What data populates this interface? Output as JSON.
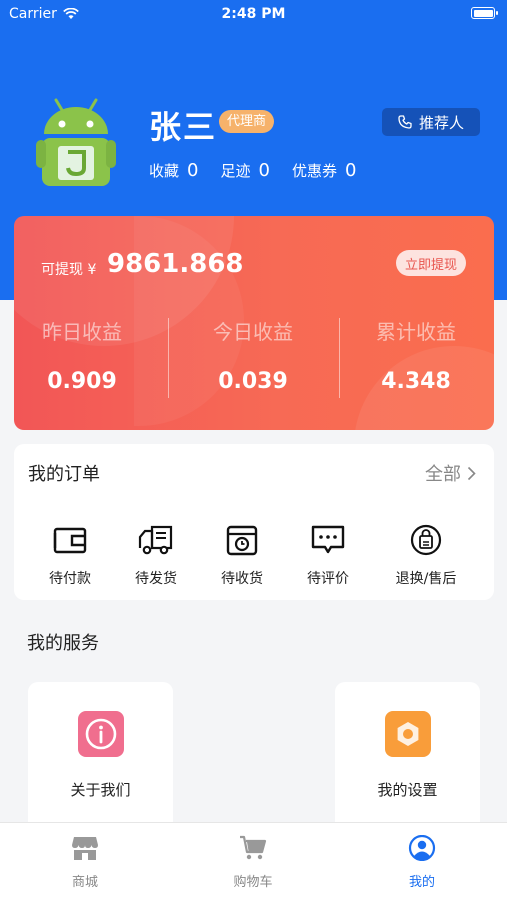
{
  "status_bar": {
    "carrier": "Carrier",
    "time": "2:48 PM"
  },
  "profile": {
    "name": "张三",
    "role_badge": "代理商",
    "referrer_label": "推荐人",
    "stats": [
      {
        "label": "收藏",
        "value": "0"
      },
      {
        "label": "足迹",
        "value": "0"
      },
      {
        "label": "优惠券",
        "value": "0"
      }
    ]
  },
  "earnings": {
    "withdrawable_label": "可提现 ¥",
    "withdrawable_amount": "9861.868",
    "withdraw_button": "立即提现",
    "columns": [
      {
        "label": "昨日收益",
        "value": "0.909"
      },
      {
        "label": "今日收益",
        "value": "0.039"
      },
      {
        "label": "累计收益",
        "value": "4.348"
      }
    ]
  },
  "orders": {
    "title": "我的订单",
    "all_label": "全部",
    "items": [
      {
        "label": "待付款",
        "icon": "wallet-icon"
      },
      {
        "label": "待发货",
        "icon": "truck-icon"
      },
      {
        "label": "待收货",
        "icon": "package-icon"
      },
      {
        "label": "待评价",
        "icon": "comment-icon"
      },
      {
        "label": "退换/售后",
        "icon": "return-bag-icon"
      }
    ]
  },
  "services": {
    "title": "我的服务",
    "items": [
      {
        "label": "关于我们",
        "icon": "info-icon",
        "color": "#f06e8e"
      },
      {
        "label": "我的设置",
        "icon": "settings-icon",
        "color": "#f99d3a"
      }
    ]
  },
  "tab_bar": {
    "active_color": "#1a6ef0",
    "items": [
      {
        "label": "商城",
        "icon": "store-icon",
        "active": false
      },
      {
        "label": "购物车",
        "icon": "cart-icon",
        "active": false
      },
      {
        "label": "我的",
        "icon": "user-icon",
        "active": true
      }
    ]
  },
  "colors": {
    "header_blue": "#1a6ef0",
    "card_red": "#f25656",
    "badge_orange": "#f6b26b"
  }
}
